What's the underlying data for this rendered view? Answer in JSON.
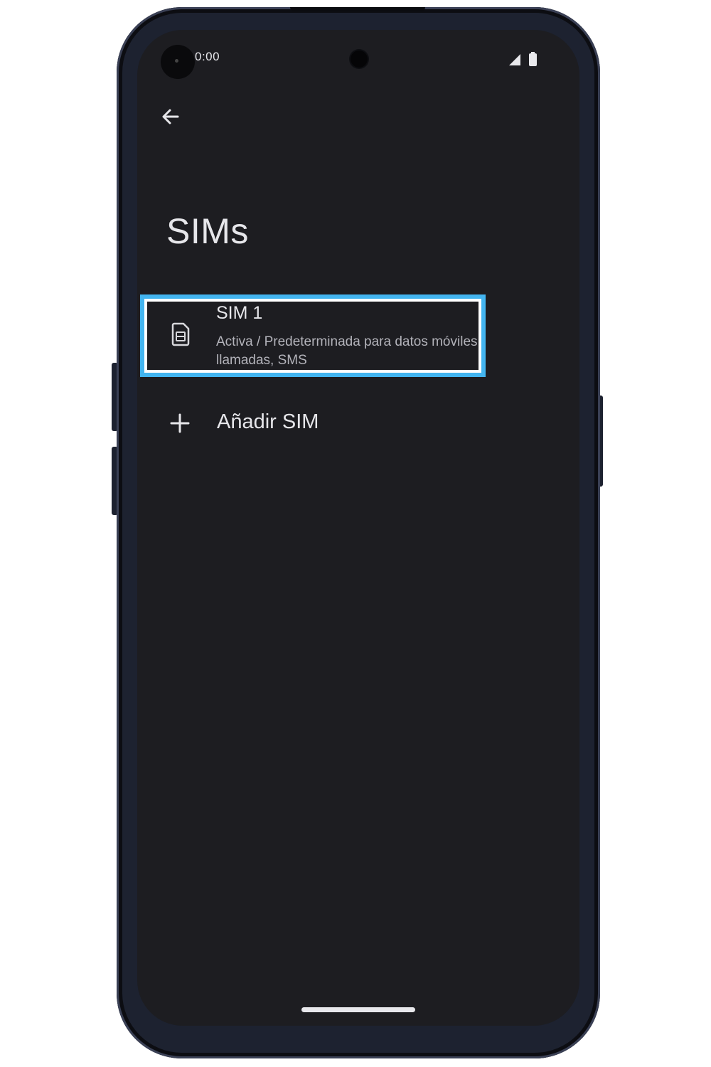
{
  "status_bar": {
    "time": "0:00",
    "icons": [
      "signal-icon",
      "battery-icon"
    ]
  },
  "toolbar": {
    "back_icon": "arrow-back-icon"
  },
  "page": {
    "title": "SIMs"
  },
  "sim_list": {
    "items": [
      {
        "title": "SIM 1",
        "subtitle": "Activa / Predeterminada para datos móviles, llamadas, SMS",
        "icon": "sim-card-icon"
      }
    ],
    "add": {
      "label": "Añadir SIM",
      "icon": "plus-icon"
    }
  },
  "colors": {
    "screen_bg": "#1d1d21",
    "text_primary": "#e6e6ea",
    "text_secondary": "#b3b3ba",
    "highlight": "#43b5f0",
    "phone_frame": "#1d2230"
  }
}
